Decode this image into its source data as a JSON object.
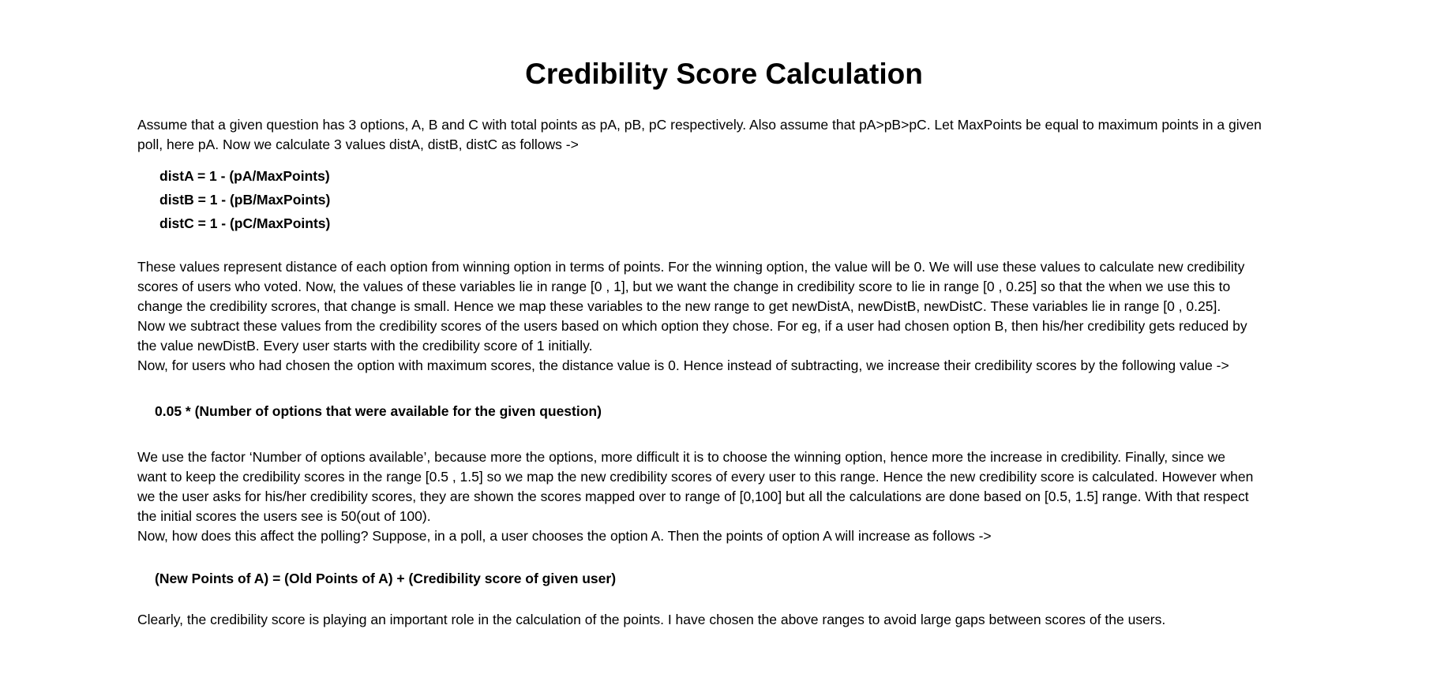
{
  "title": "Credibility Score Calculation",
  "intro": [
    "Assume that a given question has 3 options, A, B and C with total points as pA, pB, pC respectively. Also assume that pA>pB>pC. Let MaxPoints be equal to maximum points in a given",
    "poll, here pA. Now we calculate 3 values distA, distB, distC as follows ->"
  ],
  "dist_formulas": [
    "distA = 1 - (pA/MaxPoints)",
    "distB = 1 - (pB/MaxPoints)",
    "distC = 1 - (pC/MaxPoints)"
  ],
  "explanation": [
    "These values represent distance of each option from winning option in terms of points. For the winning option, the value will be 0. We will use these values to calculate new credibility",
    "scores of users who voted. Now, the values of these variables lie in range [0 , 1], but we want the change in credibility score to lie in range [0 , 0.25] so that the when we use this to",
    "change the credibility scrores, that change is small. Hence we map these variables to the new range to get newDistA, newDistB, newDistC. These variables lie in range [0 , 0.25].",
    "Now we subtract these values from the credibility scores of the users based on which option they chose. For eg, if a user had chosen option B, then his/her credibility gets reduced by",
    "the value newDistB. Every user starts with the credibility score of 1 initially.",
    "Now, for users who had chosen the option with maximum scores, the distance value is 0. Hence instead of subtracting, we increase their credibility scores by the following value ->"
  ],
  "increase_formula": "0.05 * (Number of options that were available for the given question)",
  "mapping": [
    "We use the factor ‘Number of options available’, because more the options, more difficult it is to choose the winning option, hence more the increase in credibility. Finally, since we",
    "want to keep the credibility scores in the range [0.5 , 1.5] so we map the new credibility scores of every user to this range.  Hence the new credibility score is calculated. However when",
    "we the user asks for his/her credibility scores, they are shown the scores mapped over to range of [0,100] but all the calculations are done based on [0.5, 1.5] range. With that respect",
    "the initial scores the users see is 50(out of 100).",
    "Now, how does this affect the polling? Suppose, in a poll, a user chooses the option A. Then the points of option A will increase as follows ->"
  ],
  "points_formula": "(New Points of A) = (Old Points of A) + (Credibility score of given user)",
  "conclusion": "Clearly, the credibility score is playing an important role in the calculation of the points. I have chosen the above ranges to avoid large gaps between scores of  the users."
}
